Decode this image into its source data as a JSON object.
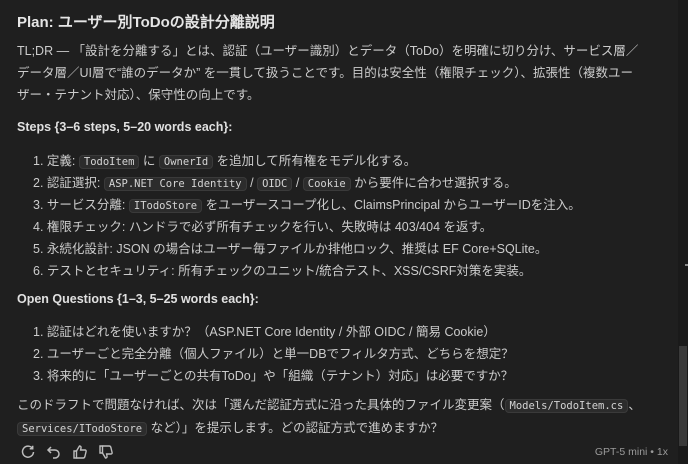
{
  "title": "Plan: ユーザー別ToDoの設計分離説明",
  "tldr": [
    "TL;DR — 「設計を分離する」とは、認証（ユーザー識別）とデータ（ToDo）を明確に切り分け、サービス層／",
    "データ層／UI層で“誰のデータか” を一貫して扱うことです。目的は安全性（権限チェック）、拡張性（複数ユー",
    "ザー・テナント対応）、保守性の向上です。"
  ],
  "steps_heading": "Steps {3–6 steps, 5–20 words each}:",
  "steps": [
    {
      "num": "1.",
      "a": "定義: ",
      "c1": "TodoItem",
      "b": " に ",
      "c2": "OwnerId",
      "c": " を追加して所有権をモデル化する。"
    },
    {
      "num": "2.",
      "a": "認証選択: ",
      "c1": "ASP.NET Core Identity",
      "b": " / ",
      "c2": "OIDC",
      "c": " / ",
      "c3": "Cookie",
      "d": " から要件に合わせ選択する。"
    },
    {
      "num": "3.",
      "a": "サービス分離: ",
      "c1": "ITodoStore",
      "b": " をユーザースコープ化し、ClaimsPrincipal からユーザーIDを注入。"
    },
    {
      "num": "4.",
      "a": "権限チェック: ハンドラで必ず所有チェックを行い、失敗時は 403/404 を返す。"
    },
    {
      "num": "5.",
      "a": "永続化設計: JSON の場合はユーザー毎ファイルか排他ロック、推奨は EF Core+SQLite。"
    },
    {
      "num": "6.",
      "a": "テストとセキュリティ: 所有チェックのユニット/統合テスト、XSS/CSRF対策を実装。"
    }
  ],
  "questions_heading": "Open Questions {1–3, 5–25 words each}:",
  "questions": [
    {
      "num": "1.",
      "text": "認証はどれを使いますか？（ASP.NET Core Identity / 外部 OIDC / 簡易 Cookie）"
    },
    {
      "num": "2.",
      "text": "ユーザーごと完全分離（個人ファイル）と単一DBでフィルタ方式、どちらを想定？"
    },
    {
      "num": "3.",
      "text": "将来的に「ユーザーごとの共有ToDo」や「組織（テナント）対応」は必要ですか？"
    }
  ],
  "closing": {
    "l1a": "このドラフトで問題なければ、次は「選んだ認証方式に沿った具体的ファイル変更案（",
    "code1": "Models/TodoItem.cs",
    "l1b": "、",
    "code2": "Services/ITodoStore",
    "l2": " など）」を提示します。どの認証方式で進めますか？"
  },
  "footer": {
    "model": "GPT-5 mini • 1x",
    "icons": [
      "retry-icon",
      "undo-icon",
      "thumbs-up-icon",
      "thumbs-down-icon"
    ]
  }
}
